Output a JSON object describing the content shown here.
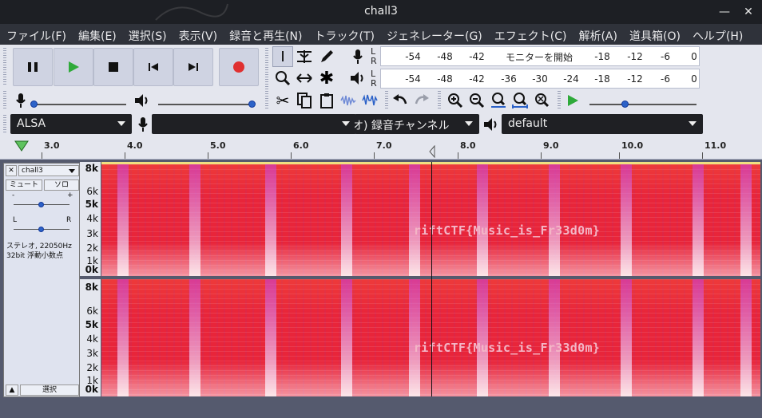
{
  "window": {
    "title": "chall3"
  },
  "menu": [
    "ファイル(F)",
    "編集(E)",
    "選択(S)",
    "表示(V)",
    "録音と再生(N)",
    "トラック(T)",
    "ジェネレーター(G)",
    "エフェクト(C)",
    "解析(A)",
    "道具箱(O)",
    "ヘルプ(H)"
  ],
  "meters": {
    "record_ticks": [
      "-54",
      "-48",
      "-42",
      "-18",
      "-12",
      "-6",
      "0"
    ],
    "playback_ticks": [
      "-54",
      "-48",
      "-42",
      "-36",
      "-30",
      "-24",
      "-18",
      "-12",
      "-6",
      "0"
    ],
    "monitor_label": "モニターを開始",
    "lr": [
      "L",
      "R"
    ]
  },
  "devices": {
    "host": "ALSA",
    "record_channels": "オ) 録音チャンネル",
    "playback_device": "default"
  },
  "timeline": {
    "labels": [
      "3.0",
      "4.0",
      "5.0",
      "6.0",
      "7.0",
      "8.0",
      "9.0",
      "10.0",
      "11.0"
    ]
  },
  "track": {
    "name": "chall3",
    "mute": "ミュート",
    "solo": "ソロ",
    "gain_minus": "-",
    "gain_plus": "+",
    "pan_left": "L",
    "pan_right": "R",
    "info_line1": "ステレオ, 22050Hz",
    "info_line2": "32bit 浮動小数点",
    "select": "選択",
    "freq_labels": [
      "8k",
      "6k",
      "5k",
      "4k",
      "3k",
      "2k",
      "1k",
      "0k"
    ],
    "flag_text": "riftCTF{Music_is_Fr33d0m}"
  },
  "colors": {
    "spectrogram": "#e8253a",
    "accent": "#2c62c8",
    "record": "#e03030",
    "play": "#2faa3a"
  }
}
